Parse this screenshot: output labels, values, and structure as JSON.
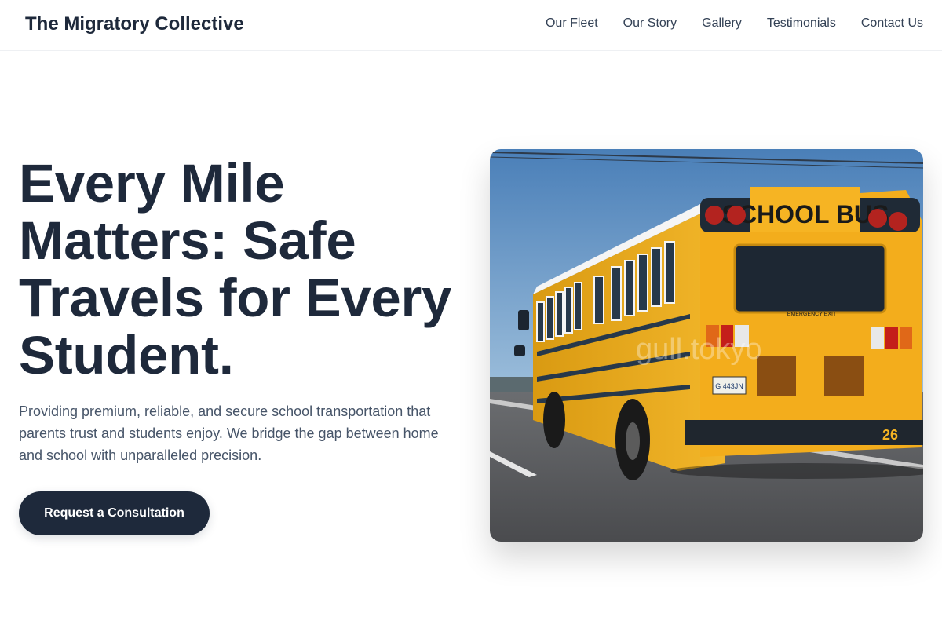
{
  "header": {
    "brand": "The Migratory Collective",
    "nav": [
      "Our Fleet",
      "Our Story",
      "Gallery",
      "Testimonials",
      "Contact Us"
    ]
  },
  "hero": {
    "title": "Every Mile Matters: Safe Travels for Every Student.",
    "subtitle": "Providing premium, reliable, and secure school transportation that parents trust and students enjoy. We bridge the gap between home and school with unparalleled precision.",
    "cta_label": "Request a Consultation"
  },
  "image": {
    "bus_sign": "SCHOOL BUS",
    "bus_number": "26",
    "emergency_label": "EMERGENCY EXIT",
    "plate": "G 443JN",
    "watermark": "gull.tokyo"
  }
}
